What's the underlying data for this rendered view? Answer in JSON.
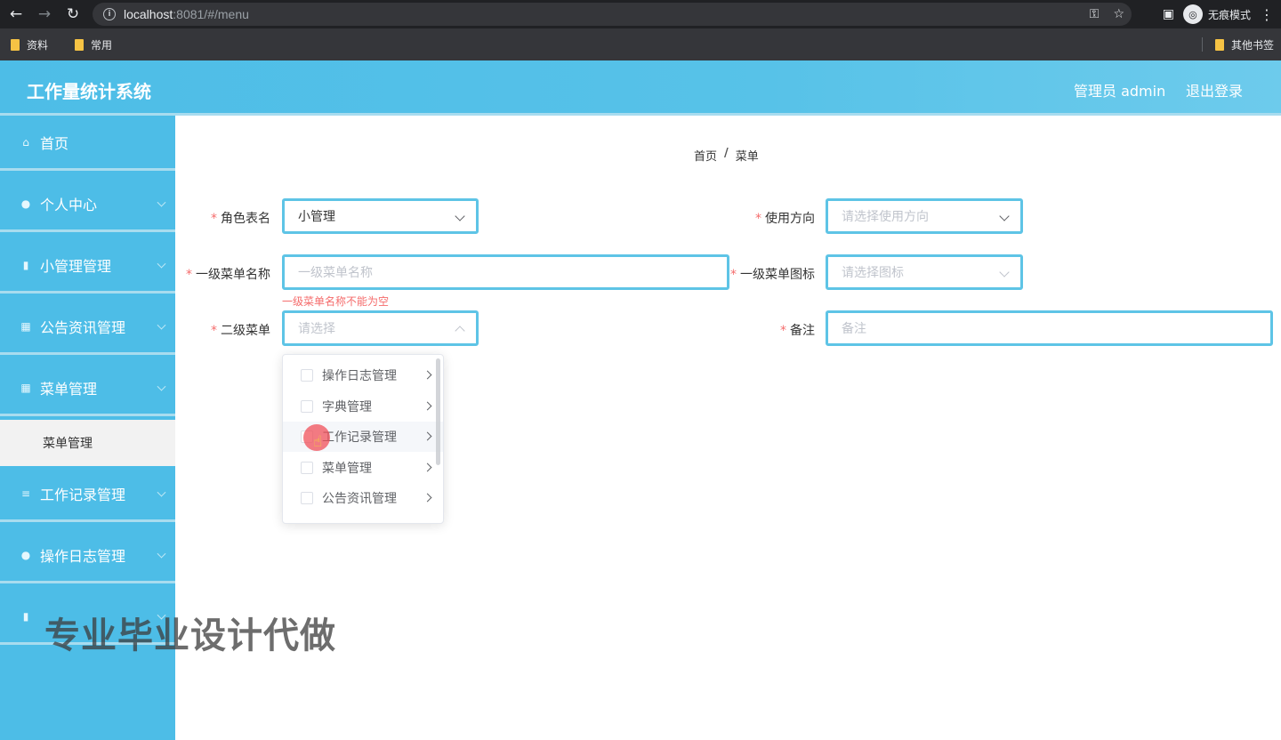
{
  "browser": {
    "url_host": "localhost",
    "url_rest": ":8081/#/menu",
    "incognito_label": "无痕模式",
    "bookmarks": [
      "资料",
      "常用"
    ],
    "bookmarks_right": "其他书签"
  },
  "header": {
    "title": "工作量统计系统",
    "user": "管理员 admin",
    "logout": "退出登录"
  },
  "sidebar": {
    "items": [
      {
        "label": "首页",
        "icon": "home-icon"
      },
      {
        "label": "个人中心",
        "icon": "user-icon"
      },
      {
        "label": "小管理管理",
        "icon": "clipboard-icon"
      },
      {
        "label": "公告资讯管理",
        "icon": "grid-icon"
      },
      {
        "label": "菜单管理",
        "icon": "grid-icon"
      },
      {
        "label": "工作记录管理",
        "icon": "list-icon"
      },
      {
        "label": "操作日志管理",
        "icon": "user-icon"
      }
    ],
    "submenu": "菜单管理"
  },
  "breadcrumb": {
    "home": "首页",
    "separator": "/",
    "current": "菜单"
  },
  "form": {
    "role": {
      "label": "角色表名",
      "value": "小管理"
    },
    "direction": {
      "label": "使用方向",
      "placeholder": "请选择使用方向"
    },
    "menu1_name": {
      "label": "一级菜单名称",
      "placeholder": "一级菜单名称",
      "error": "一级菜单名称不能为空"
    },
    "menu1_icon": {
      "label": "一级菜单图标",
      "placeholder": "请选择图标"
    },
    "menu2": {
      "label": "二级菜单",
      "placeholder": "请选择"
    },
    "remark": {
      "label": "备注",
      "placeholder": "备注"
    }
  },
  "dropdown": {
    "options": [
      "操作日志管理",
      "字典管理",
      "工作记录管理",
      "菜单管理",
      "公告资讯管理"
    ]
  },
  "watermark": "专业毕业设计代做",
  "colors": {
    "accent": "#4dbde7",
    "error": "#f56c6c",
    "border": "#5ec4e6"
  }
}
